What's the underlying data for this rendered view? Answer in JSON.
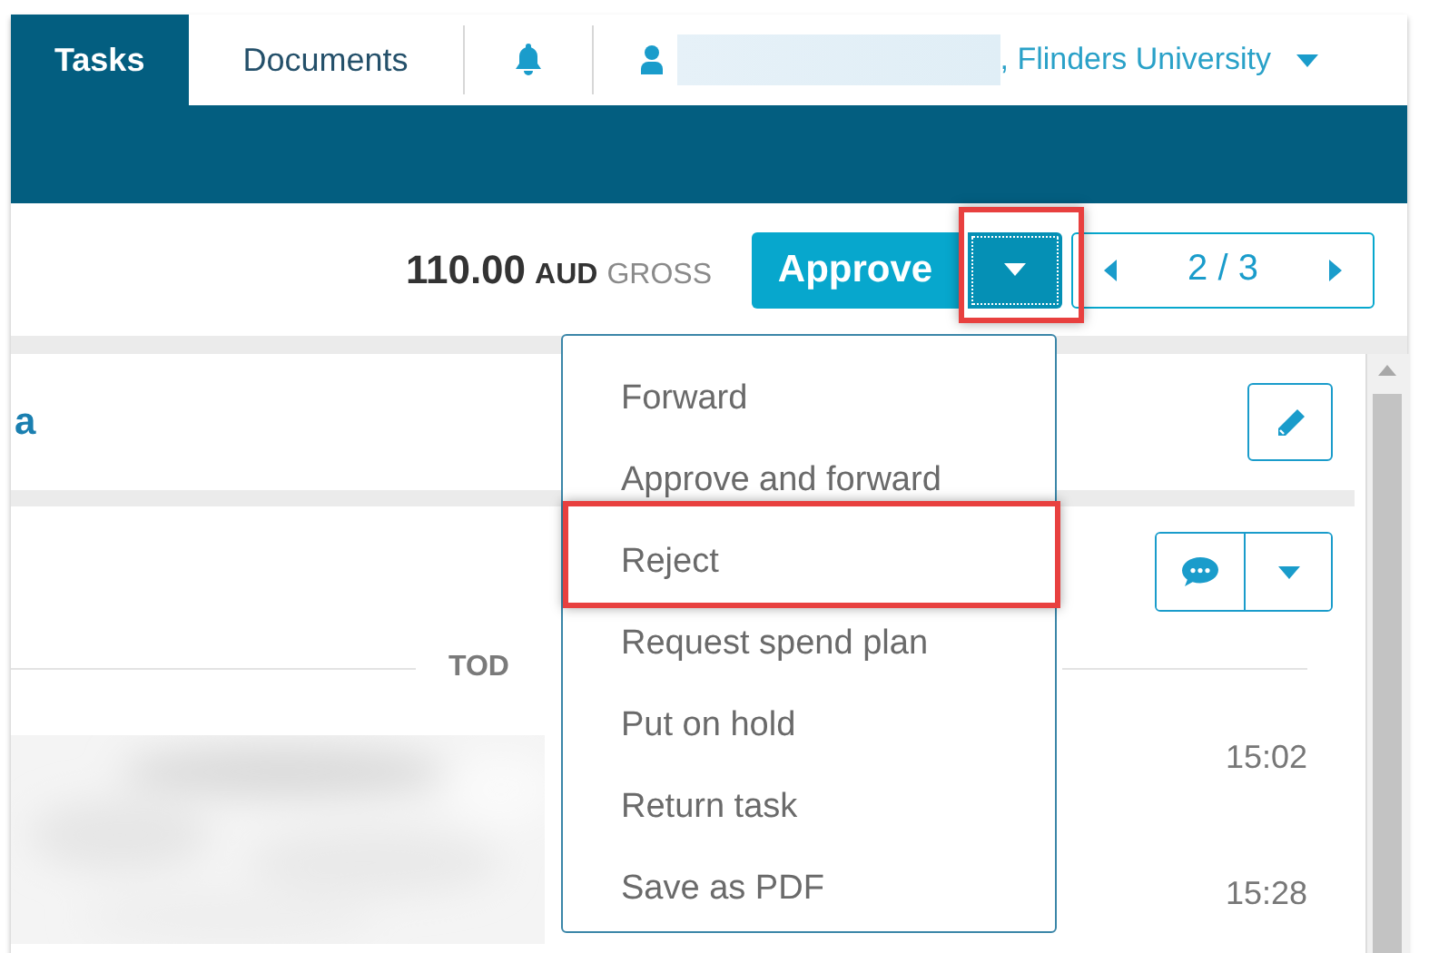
{
  "header": {
    "tabs": [
      {
        "label": "Tasks",
        "selected": true
      },
      {
        "label": "Documents",
        "selected": false
      }
    ],
    "user": {
      "organization": ", Flinders University"
    }
  },
  "toolbar": {
    "amount": "110.00",
    "currency": "AUD",
    "amount_type": "GROSS",
    "approve_button": "Approve",
    "more_button_highlighted": true,
    "pager": "2 / 3"
  },
  "sections": [
    {
      "title": "a"
    },
    {
      "divider_label": "TOD",
      "times": [
        "15:02",
        "15:28"
      ]
    }
  ],
  "menu": {
    "items": [
      {
        "label": "Forward",
        "highlighted": false
      },
      {
        "label": "Approve and forward",
        "highlighted": false
      },
      {
        "label": "Reject",
        "highlighted": true
      },
      {
        "label": "Request spend plan",
        "highlighted": false
      },
      {
        "label": "Put on hold",
        "highlighted": false
      },
      {
        "label": "Return task",
        "highlighted": false
      },
      {
        "label": "Save as PDF",
        "highlighted": false
      }
    ]
  }
}
